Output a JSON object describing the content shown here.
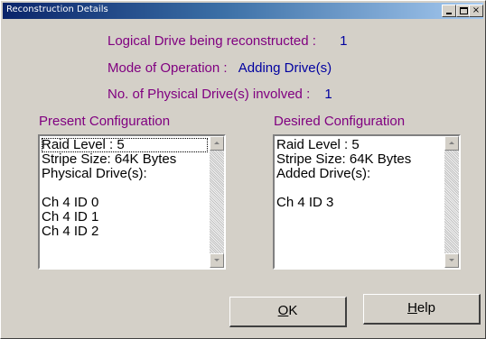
{
  "window": {
    "title": "Reconstruction Details",
    "min_glyph": "_",
    "max_glyph": "□",
    "close_glyph": "×"
  },
  "info": {
    "logical_drive_label": "Logical Drive  being reconstructed :",
    "logical_drive_value": "1",
    "mode_label": "Mode of Operation :",
    "mode_value": "Adding Drive(s)",
    "physical_label": "No. of Physical Drive(s) involved :",
    "physical_value": "1"
  },
  "present": {
    "title": "Present Configuration",
    "lines": [
      "Raid Level : 5",
      "Stripe Size: 64K Bytes",
      "Physical Drive(s):",
      "",
      "Ch 4 ID 0",
      "Ch 4 ID 1",
      "Ch 4 ID 2"
    ]
  },
  "desired": {
    "title": "Desired Configuration",
    "lines": [
      "Raid Level : 5",
      "Stripe Size: 64K Bytes",
      "Added Drive(s):",
      "",
      "Ch 4 ID 3"
    ]
  },
  "buttons": {
    "ok_accel": "O",
    "ok_rest": "K",
    "help_accel": "H",
    "help_rest": "elp"
  }
}
